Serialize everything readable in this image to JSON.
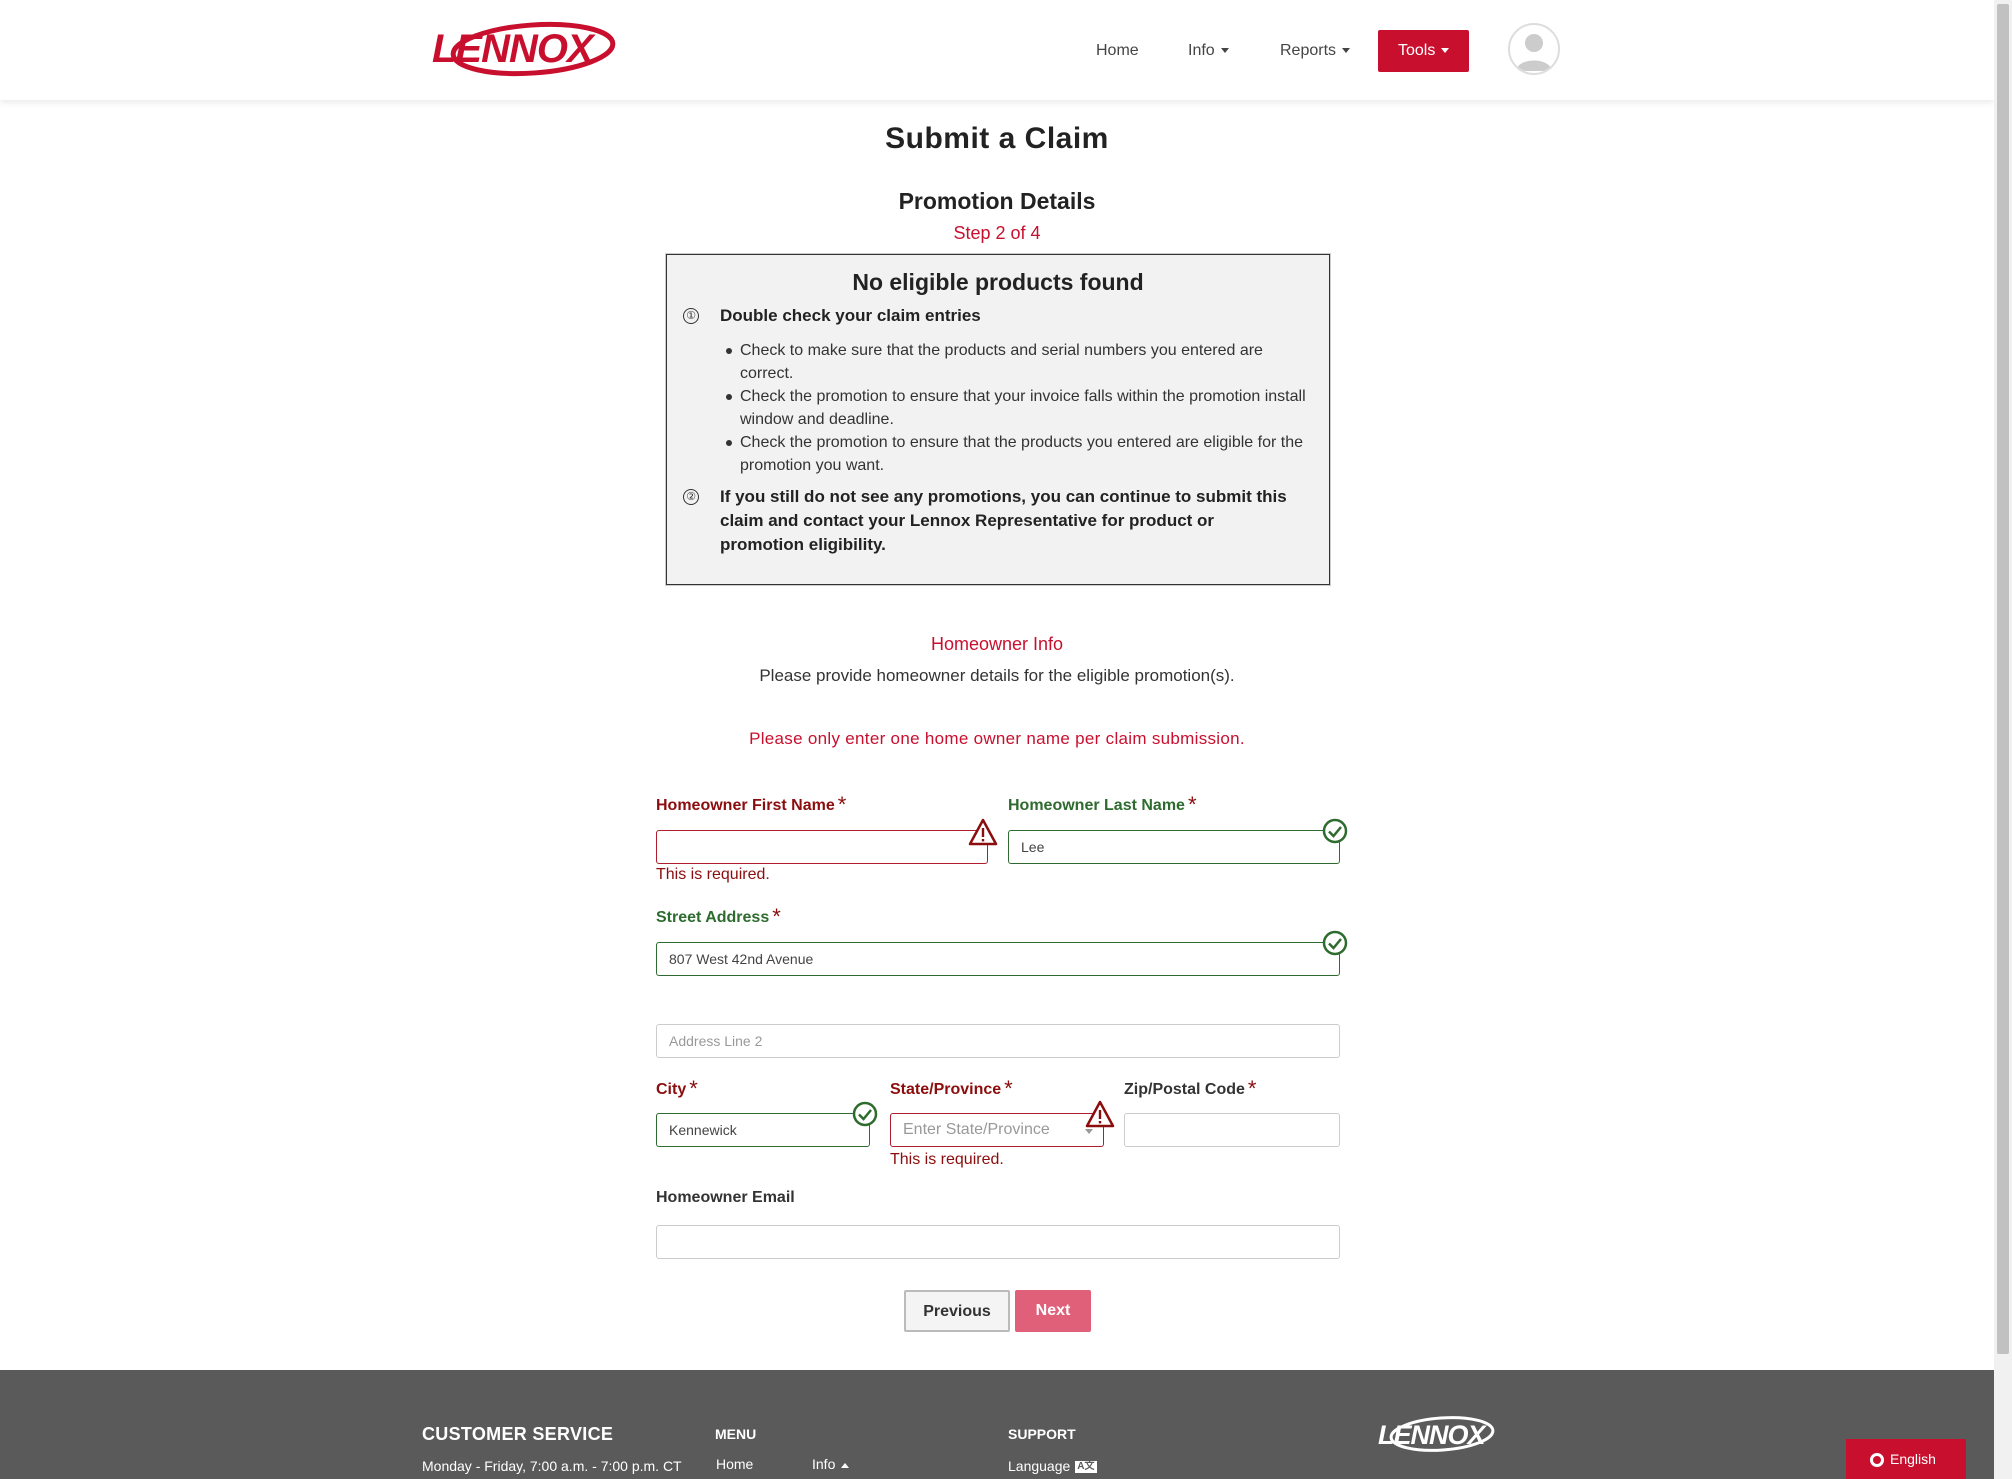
{
  "header": {
    "logo_text": "LENNOX",
    "nav": {
      "home": "Home",
      "info": "Info",
      "reports": "Reports",
      "tools": "Tools"
    }
  },
  "page": {
    "title": "Submit a Claim",
    "subtitle": "Promotion Details",
    "step": "Step 2 of 4"
  },
  "alert": {
    "title": "No eligible products found",
    "icon1": "①",
    "heading1": "Double check your claim entries",
    "items": [
      "Check to make sure that the products and serial numbers you entered are correct.",
      "Check the promotion to ensure that your invoice falls within the promotion install window and deadline.",
      "Check the promotion to ensure that the products you entered are eligible for the promotion you want."
    ],
    "icon2": "②",
    "heading2": "If you still do not see any promotions, you can continue to submit this claim and contact your Lennox Representative for product or promotion eligibility."
  },
  "homeowner": {
    "section_title": "Homeowner Info",
    "description": "Please provide homeowner details for the eligible promotion(s).",
    "notice": "Please only enter one home owner name per claim submission."
  },
  "form": {
    "first_name_label": "Homeowner First Name",
    "first_name_value": "",
    "first_name_error": "This is required.",
    "last_name_label": "Homeowner Last Name",
    "last_name_value": "Lee",
    "street_label": "Street Address",
    "street_value": "807 West 42nd Avenue",
    "address2_placeholder": "Address Line 2",
    "city_label": "City",
    "city_value": "Kennewick",
    "state_label": "State/Province",
    "state_placeholder": "Enter State/Province",
    "state_error": "This is required.",
    "zip_label": "Zip/Postal Code",
    "zip_value": "",
    "email_label": "Homeowner Email",
    "email_value": "",
    "required_mark": "*"
  },
  "buttons": {
    "previous": "Previous",
    "next": "Next"
  },
  "footer": {
    "customer_service": "CUSTOMER SERVICE",
    "hours": "Monday - Friday, 7:00 a.m. - 7:00 p.m. CT",
    "menu_heading": "MENU",
    "menu_home": "Home",
    "menu_info": "Info",
    "support_heading": "SUPPORT",
    "support_language": "Language",
    "logo_text": "LENNOX",
    "language_button": "English"
  },
  "colors": {
    "brand_red": "#c8102e",
    "error_red": "#8b0d0d",
    "success_green": "#2e6b2e",
    "footer_gray": "#5a5a5a"
  }
}
